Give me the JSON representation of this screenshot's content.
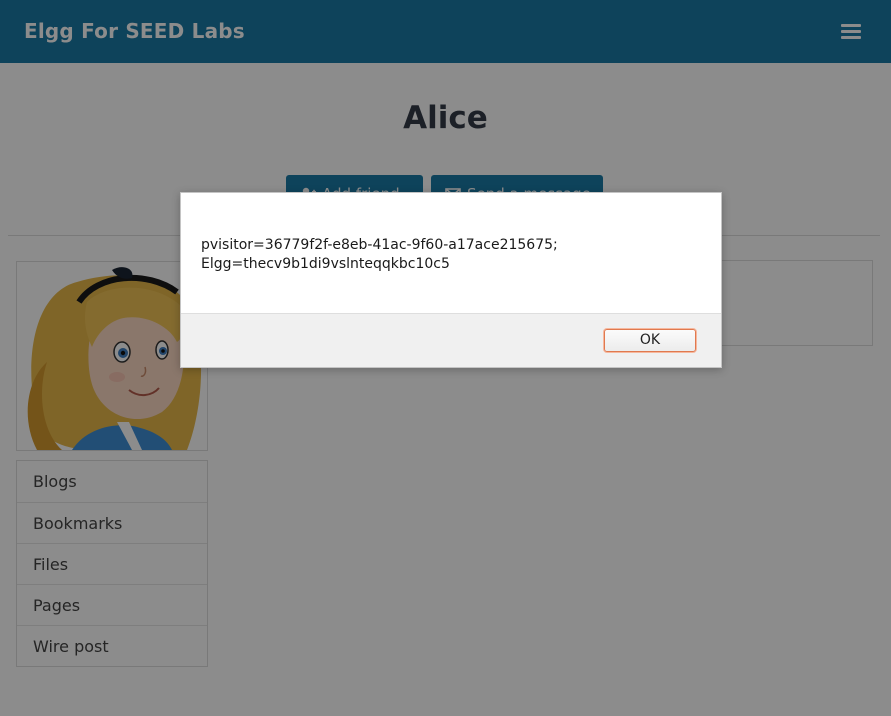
{
  "header": {
    "site_title": "Elgg For SEED Labs",
    "menu_icon": "hamburger-menu-icon",
    "bar_color": "#1a7ba6"
  },
  "profile": {
    "name": "Alice",
    "buttons": {
      "add_friend": "Add friend",
      "send_message": "Send a message"
    },
    "avatar_icon": "alice-avatar-image"
  },
  "owner_menu": {
    "items": [
      {
        "label": "Blogs"
      },
      {
        "label": "Bookmarks"
      },
      {
        "label": "Files"
      },
      {
        "label": "Pages"
      },
      {
        "label": "Wire post"
      }
    ]
  },
  "alert": {
    "message_line1": "pvisitor=36779f2f-e8eb-41ac-9f60-a17ace215675;",
    "message_line2": "Elgg=thecv9b1di9vslnteqqkbc10c5",
    "ok_label": "OK",
    "ok_focus_color": "#e0794f"
  }
}
